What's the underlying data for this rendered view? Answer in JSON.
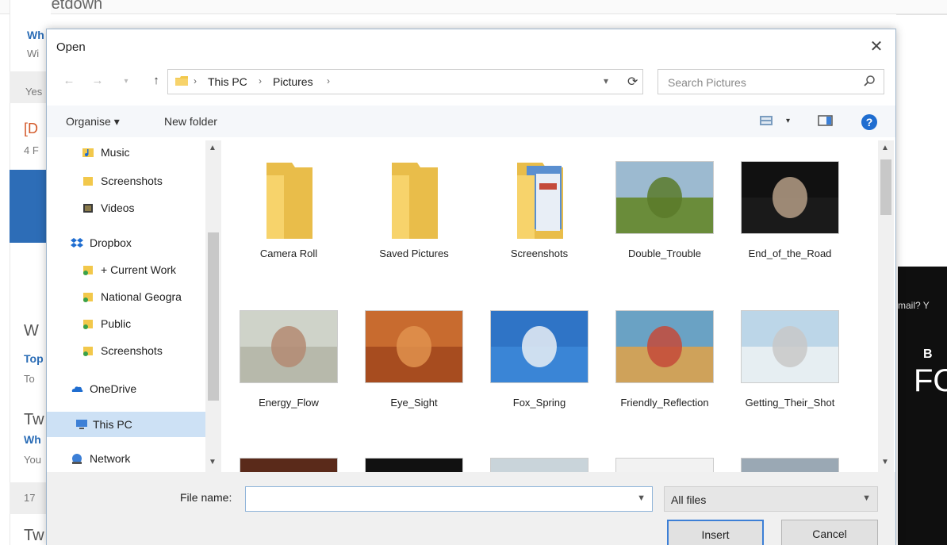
{
  "background": {
    "top_text": "Tweetdown",
    "fragments": [
      "Wh",
      "Wi",
      "Yes",
      "[D",
      "4 F",
      "W",
      "Top",
      "To",
      "Tw",
      "Wh",
      "You",
      "17",
      "Tw",
      "mail? Y",
      "B",
      "FO"
    ]
  },
  "dialog": {
    "title": "Open",
    "close_symbol": "✕"
  },
  "address_bar": {
    "crumbs": [
      "This PC",
      "Pictures"
    ],
    "search_placeholder": "Search Pictures"
  },
  "toolbar": {
    "organise_label": "Organise ▾",
    "new_folder_label": "New folder"
  },
  "nav_pane": {
    "items": [
      {
        "label": "Music",
        "icon": "music-folder-icon"
      },
      {
        "label": "Screenshots",
        "icon": "folder-icon"
      },
      {
        "label": "Videos",
        "icon": "videos-folder-icon"
      },
      {
        "label": "Dropbox",
        "icon": "dropbox-icon"
      },
      {
        "label": "+ Current Work",
        "icon": "dropbox-folder-icon"
      },
      {
        "label": "National Geogra",
        "icon": "dropbox-folder-icon"
      },
      {
        "label": "Public",
        "icon": "dropbox-folder-icon"
      },
      {
        "label": "Screenshots",
        "icon": "dropbox-folder-icon"
      },
      {
        "label": "OneDrive",
        "icon": "onedrive-icon"
      },
      {
        "label": "This PC",
        "icon": "computer-icon"
      },
      {
        "label": "Network",
        "icon": "network-icon"
      }
    ],
    "selected": "This PC"
  },
  "content": {
    "items": [
      {
        "caption": "Camera Roll",
        "kind": "folder"
      },
      {
        "caption": "Saved Pictures",
        "kind": "folder"
      },
      {
        "caption": "Screenshots",
        "kind": "folder-with-contents"
      },
      {
        "caption": "Double_Trouble",
        "kind": "image",
        "colors": [
          "#9cbad0",
          "#6a8c3a",
          "#5a7a2a"
        ]
      },
      {
        "caption": "End_of_the_Road",
        "kind": "image",
        "colors": [
          "#111111",
          "#1a1a1a",
          "#b59e86"
        ]
      },
      {
        "caption": "Energy_Flow",
        "kind": "image",
        "colors": [
          "#cfd3c9",
          "#b7b9ab",
          "#b48a72"
        ]
      },
      {
        "caption": "Eye_Sight",
        "kind": "image",
        "colors": [
          "#c86b2f",
          "#a74c1f",
          "#e0924e"
        ]
      },
      {
        "caption": "Fox_Spring",
        "kind": "image",
        "colors": [
          "#2f74c6",
          "#3a85d6",
          "#e9eef5"
        ]
      },
      {
        "caption": "Friendly_Reflection",
        "kind": "image",
        "colors": [
          "#6aa2c4",
          "#cfa25a",
          "#c44a3a"
        ]
      },
      {
        "caption": "Getting_Their_Shot",
        "kind": "image",
        "colors": [
          "#bcd6e8",
          "#e6eef2",
          "#c8c8c8"
        ]
      },
      {
        "caption": "",
        "kind": "image",
        "colors": [
          "#5a2a1a",
          "#c25a3a",
          "#2a1a12"
        ]
      },
      {
        "caption": "",
        "kind": "image",
        "colors": [
          "#111111",
          "#777777",
          "#d6d6d6"
        ]
      },
      {
        "caption": "",
        "kind": "image",
        "colors": [
          "#c9d4da",
          "#556055",
          "#2a2a2a"
        ]
      },
      {
        "caption": "",
        "kind": "image",
        "colors": [
          "#f2f2f2",
          "#9a9a9a",
          "#d0d0d0"
        ]
      },
      {
        "caption": "",
        "kind": "image",
        "colors": [
          "#9aa8b4",
          "#d8dfe4",
          "#6b7986"
        ]
      }
    ]
  },
  "bottom": {
    "file_name_label": "File name:",
    "file_name_value": "",
    "filter_value": "All files",
    "insert_label": "Insert",
    "cancel_label": "Cancel"
  },
  "colors": {
    "accent": "#3c7fd6",
    "selected_bg": "#cde1f5",
    "folder_yellow": "#f7d36b"
  }
}
